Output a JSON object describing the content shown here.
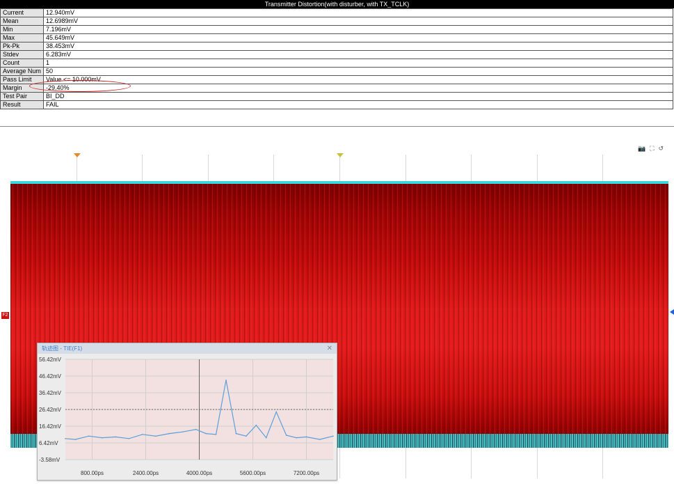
{
  "results": {
    "title": "Transmitter Distortion(with disturber, with TX_TCLK)",
    "rows": [
      {
        "label": "Current",
        "value": "12.940mV"
      },
      {
        "label": "Mean",
        "value": "12.6989mV"
      },
      {
        "label": "Min",
        "value": "7.196mV"
      },
      {
        "label": "Max",
        "value": "45.649mV"
      },
      {
        "label": "Pk-Pk",
        "value": "38.453mV"
      },
      {
        "label": "Stdev",
        "value": "6.283mV"
      },
      {
        "label": "Count",
        "value": "1"
      },
      {
        "label": "Average Num",
        "value": "50"
      },
      {
        "label": "Pass Limit",
        "value": "Value <= 10.000mV"
      },
      {
        "label": "Margin",
        "value": "-29.40%"
      },
      {
        "label": "Test Pair",
        "value": "BI_DD"
      },
      {
        "label": "Result",
        "value": "FAIL"
      }
    ]
  },
  "scope": {
    "channel_marker": "F2",
    "toolbar_icons": [
      "camera-icon",
      "fullscreen-icon",
      "restore-icon"
    ],
    "colors": {
      "waveform": "#d01010",
      "overlay": "#3fd5dd",
      "result_fail": "#e00000"
    }
  },
  "inset": {
    "title": "轨迹图 - TIE(F1)",
    "close_glyph": "✕",
    "y_ticks": [
      "56.42mV",
      "46.42mV",
      "36.42mV",
      "26.42mV",
      "16.42mV",
      "6.42mV",
      "-3.58mV"
    ],
    "x_ticks": [
      "800.00ps",
      "2400.00ps",
      "4000.00ps",
      "5600.00ps",
      "7200.00ps"
    ]
  },
  "chart_data": {
    "type": "line",
    "xlabel": "",
    "ylabel": "",
    "x_unit": "ps",
    "y_unit": "mV",
    "xlim": [
      0,
      8000
    ],
    "ylim": [
      -3.58,
      56.42
    ],
    "x_ticks": [
      800,
      2400,
      4000,
      5600,
      7200
    ],
    "y_ticks": [
      56.42,
      46.42,
      36.42,
      26.42,
      16.42,
      6.42,
      -3.58
    ],
    "grid": true,
    "series": [
      {
        "color": "#5aa0d8",
        "x": [
          0,
          300,
          700,
          1100,
          1500,
          1900,
          2300,
          2700,
          3100,
          3500,
          3900,
          4200,
          4500,
          4800,
          5100,
          5400,
          5700,
          6000,
          6300,
          6600,
          6900,
          7200,
          7600,
          8000
        ],
        "y": [
          9.0,
          8.5,
          10.5,
          9.5,
          10.0,
          9.0,
          11.5,
          10.5,
          12.0,
          13.0,
          14.5,
          12.0,
          11.5,
          44.0,
          12.0,
          10.5,
          17.0,
          9.5,
          25.0,
          11.0,
          9.5,
          10.0,
          8.5,
          10.5
        ]
      }
    ]
  }
}
